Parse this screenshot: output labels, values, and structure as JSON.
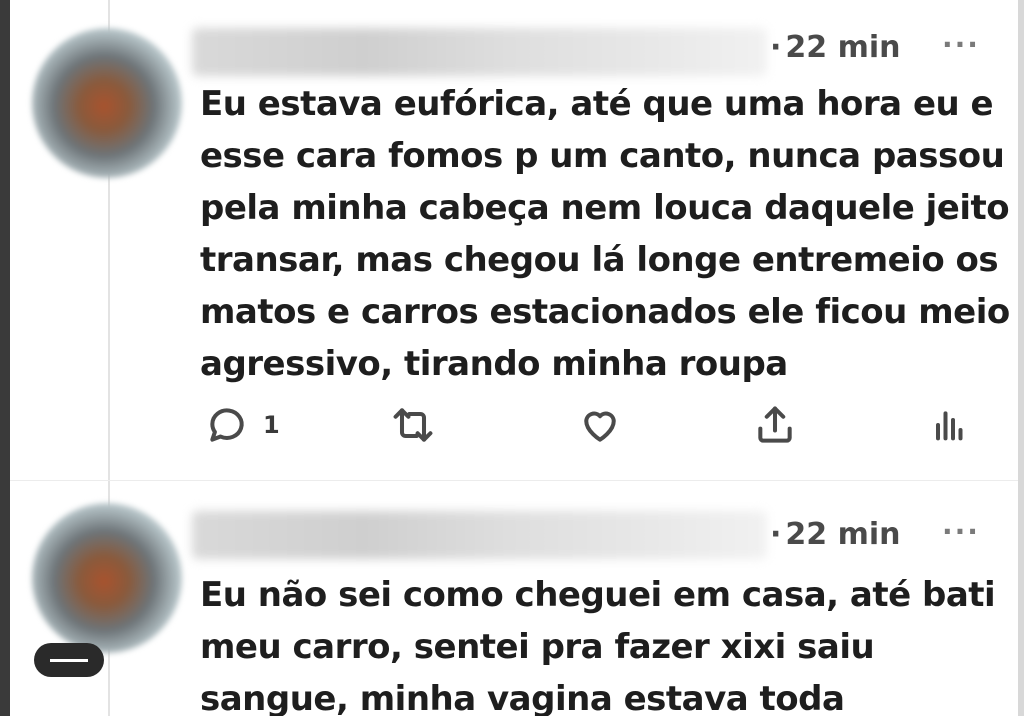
{
  "tweets": [
    {
      "timestamp": "22 min",
      "more": "···",
      "lines": [
        "Eu estava eufórica, até que uma hora eu e",
        "esse cara fomos p um canto, nunca passou",
        "pela minha cabeça nem louca daquele jeito",
        "transar, mas chegou lá longe entremeio os",
        "matos e carros estacionados ele ficou meio",
        "agressivo, tirando minha roupa"
      ],
      "actions": {
        "reply_count": "1"
      }
    },
    {
      "timestamp": "22 min",
      "more": "···",
      "lines": [
        "Eu não sei como cheguei em casa, até bati",
        "meu carro, sentei pra fazer xixi saiu",
        "sangue, minha vagina estava toda"
      ]
    }
  ],
  "icons": [
    "reply-icon",
    "retweet-icon",
    "like-icon",
    "share-icon",
    "views-icon",
    "more-icon"
  ],
  "colors": {
    "text": "#1e1e1e",
    "meta": "#4a4a4a",
    "background": "#ffffff"
  }
}
